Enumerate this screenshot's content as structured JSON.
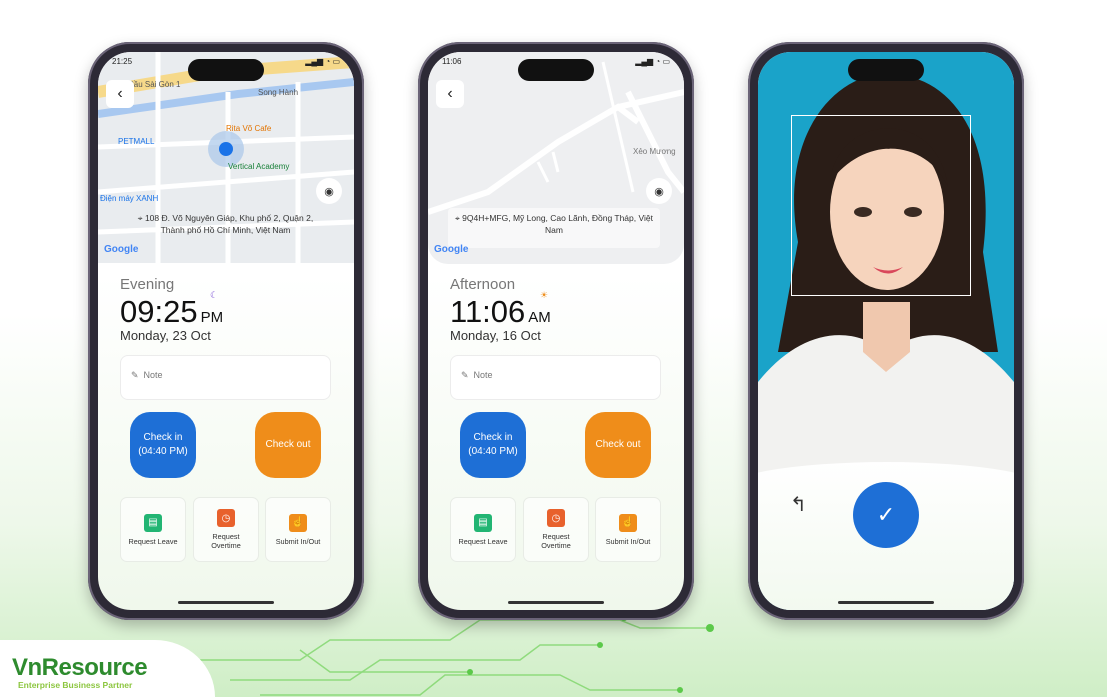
{
  "phones": [
    {
      "status_time": "21:25",
      "map_labels": [
        "Cầu Sài Gòn 1",
        "Song Hành",
        "PETMALL",
        "Rita Võ Cafe",
        "Vertical Academy",
        "Điện máy XANH"
      ],
      "address": "108 Đ. Võ Nguyên Giáp, Khu phố 2, Quận 2, Thành phố Hồ Chí Minh, Việt Nam",
      "google": "Google",
      "period": "Evening",
      "period_icon": "moon-icon",
      "time": "09:25",
      "ampm": "PM",
      "date": "Monday, 23 Oct",
      "note_placeholder": "Note",
      "check_in": "Check in",
      "check_in_time": "(04:40 PM)",
      "check_out": "Check out",
      "tiles": [
        {
          "label": "Request Leave",
          "color": "#22b573"
        },
        {
          "label": "Request Overtime",
          "color": "#e8612c"
        },
        {
          "label": "Submit In/Out",
          "color": "#ef8d1a"
        }
      ]
    },
    {
      "status_time": "11:06",
      "map_labels": [
        "Xẻo Mương"
      ],
      "address": "9Q4H+MFG, Mỹ Long, Cao Lãnh, Đồng Tháp, Việt Nam",
      "google": "Google",
      "period": "Afternoon",
      "period_icon": "sun-icon",
      "time": "11:06",
      "ampm": "AM",
      "date": "Monday, 16 Oct",
      "note_placeholder": "Note",
      "check_in": "Check in",
      "check_in_time": "(04:40 PM)",
      "check_out": "Check out",
      "tiles": [
        {
          "label": "Request Leave",
          "color": "#22b573"
        },
        {
          "label": "Request Overtime",
          "color": "#e8612c"
        },
        {
          "label": "Submit In/Out",
          "color": "#ef8d1a"
        }
      ]
    }
  ],
  "face_capture": {
    "back_icon": "undo-arrow-icon",
    "confirm_icon": "check-icon",
    "accent": "#1e6fd6"
  },
  "brand": {
    "name": "VnResource",
    "tagline": "Enterprise Business Partner",
    "color": "#2e8b2e"
  }
}
